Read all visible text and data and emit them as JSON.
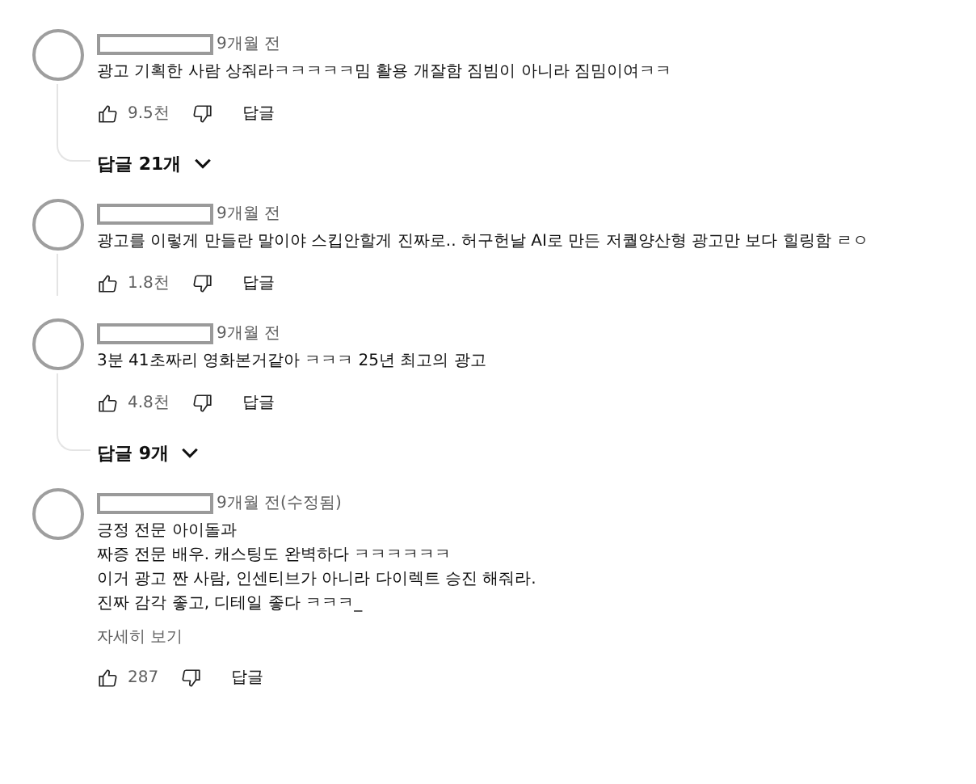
{
  "comments": [
    {
      "time": "9개월 전",
      "lines": [
        "광고 기획한 사람 상줘라ㅋㅋㅋㅋㅋ밈 활용 개잘함 짐빔이 아니라 짐밈이여ㅋㅋ"
      ],
      "likes": "9.5천",
      "reply_button": "답글",
      "thread_line": true,
      "replies": "답글 21개"
    },
    {
      "time": "9개월 전",
      "lines": [
        "광고를 이렇게 만들란 말이야 스킵안할게 진짜로.. 허구헌날 AI로 만든 저퀄양산형 광고만 보다 힐링함 ㄹㅇ"
      ],
      "likes": "1.8천",
      "reply_button": "답글",
      "thread_line": true
    },
    {
      "time": "9개월 전",
      "lines": [
        "3분 41초짜리 영화본거같아 ㅋㅋㅋ 25년 최고의 광고"
      ],
      "likes": "4.8천",
      "reply_button": "답글",
      "thread_line": true,
      "replies": "답글 9개"
    },
    {
      "time": "9개월 전(수정됨)",
      "lines": [
        "긍정 전문 아이돌과",
        "짜증 전문 배우.  캐스팅도 완벽하다 ㅋㅋㅋㅋㅋㅋ",
        "이거 광고 짠 사람, 인센티브가 아니라 다이렉트 승진 해줘라.",
        "진짜 감각 좋고, 디테일 좋다 ㅋㅋㅋ_"
      ],
      "read_more": "자세히 보기",
      "likes": "287",
      "reply_button": "답글",
      "thread_line": false
    }
  ]
}
